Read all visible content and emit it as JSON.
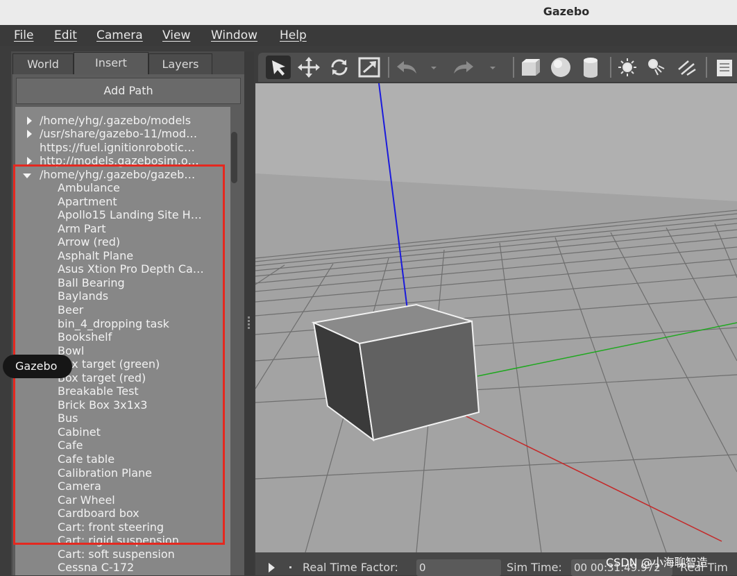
{
  "window": {
    "title": "Gazebo"
  },
  "menubar": {
    "items": [
      "File",
      "Edit",
      "Camera",
      "View",
      "Window",
      "Help"
    ]
  },
  "left_panel": {
    "tabs": [
      "World",
      "Insert",
      "Layers"
    ],
    "active_tab": "Insert",
    "add_path_label": "Add Path",
    "paths": [
      {
        "label": "/home/yhg/.gazebo/models",
        "state": "collapsed"
      },
      {
        "label": "/usr/share/gazebo-11/mod…",
        "state": "collapsed"
      },
      {
        "label": "https://fuel.ignitionrobotic…",
        "state": "none"
      },
      {
        "label": "http://models.gazebosim.o…",
        "state": "collapsed"
      },
      {
        "label": "/home/yhg/.gazebo/gazeb…",
        "state": "expanded"
      }
    ],
    "models": [
      "Ambulance",
      "Apartment",
      "Apollo15 Landing Site H…",
      "Arm Part",
      "Arrow (red)",
      "Asphalt Plane",
      "Asus Xtion Pro Depth Ca…",
      "Ball Bearing",
      "Baylands",
      "Beer",
      "bin_4_dropping task",
      "Bookshelf",
      "Bowl",
      "Box target (green)",
      "Box target (red)",
      "Breakable Test",
      "Brick Box 3x1x3",
      "Bus",
      "Cabinet",
      "Cafe",
      "Cafe table",
      "Calibration Plane",
      "Camera",
      "Car Wheel",
      "Cardboard box",
      "Cart: front steering",
      "Cart: rigid suspension",
      "Cart: soft suspension",
      "Cessna C-172"
    ]
  },
  "tooltip": {
    "text": "Gazebo"
  },
  "toolbar": {
    "tools": [
      "select-mode-icon",
      "translate-mode-icon",
      "rotate-mode-icon",
      "scale-mode-icon",
      "undo-icon",
      "redo-icon",
      "box-shape-icon",
      "sphere-shape-icon",
      "cylinder-shape-icon",
      "point-light-icon",
      "spot-light-icon",
      "directional-light-icon",
      "copy-icon"
    ]
  },
  "bottom_bar": {
    "real_time_factor_label": "Real Time Factor:",
    "real_time_factor_value": "0",
    "sim_time_label": "Sim Time:",
    "sim_time_value": "00 00:31:49.972",
    "real_time_label": "Real Tim"
  },
  "watermark": "CSDN @小海聊智造",
  "colors": {
    "highlight_box": "#e5281f",
    "z_axis": "#1a1adc",
    "y_axis": "#1fa81f",
    "x_axis": "#c42a2a"
  }
}
